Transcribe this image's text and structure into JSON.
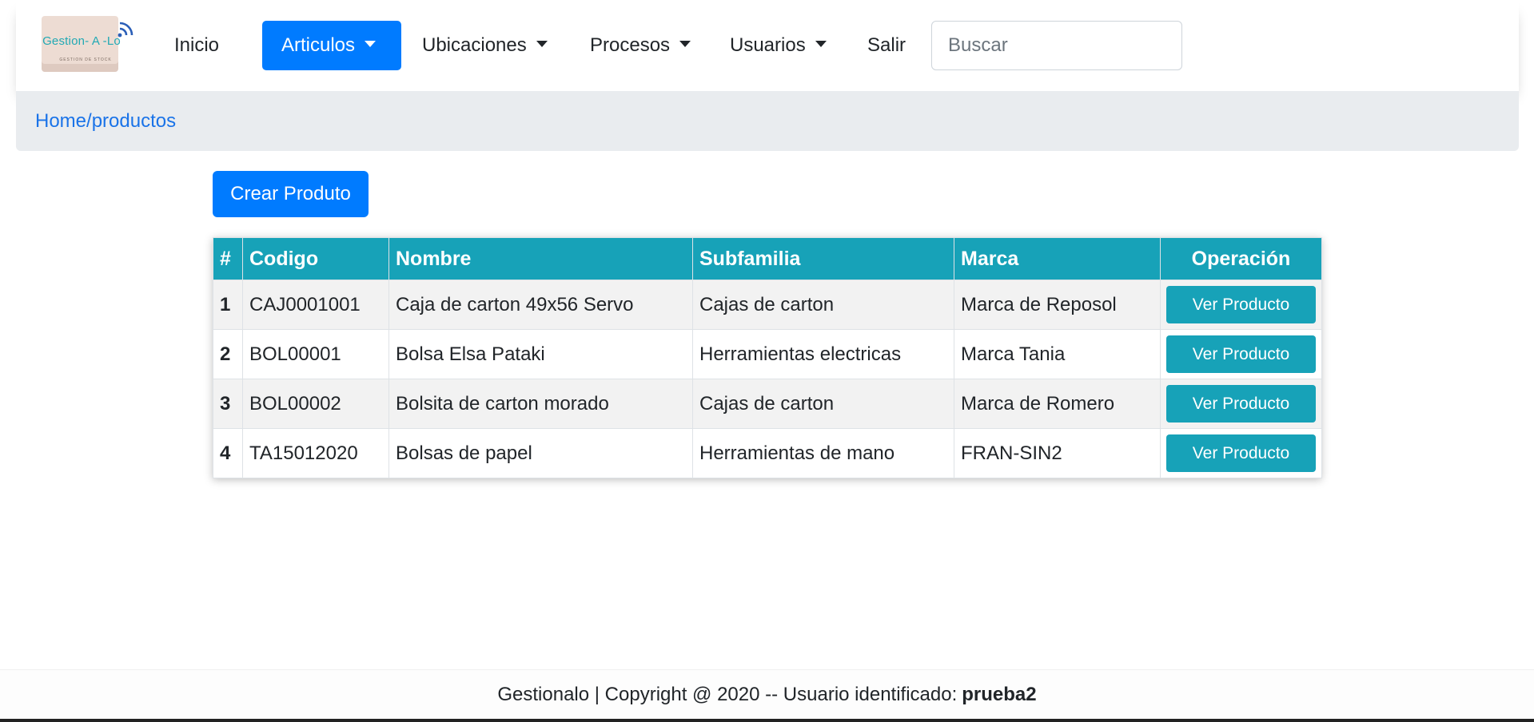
{
  "logo": {
    "text": "Gestion- A -Lo",
    "subtitle": "GESTION DE STOCK"
  },
  "nav": {
    "items": [
      {
        "label": "Inicio",
        "dropdown": false,
        "active": false
      },
      {
        "label": "Articulos",
        "dropdown": true,
        "active": true
      },
      {
        "label": "Ubicaciones",
        "dropdown": true,
        "active": false
      },
      {
        "label": "Procesos",
        "dropdown": true,
        "active": false
      },
      {
        "label": "Usuarios",
        "dropdown": true,
        "active": false
      },
      {
        "label": "Salir",
        "dropdown": false,
        "active": false
      }
    ],
    "search_placeholder": "Buscar"
  },
  "breadcrumb": "Home/productos",
  "create_button": "Crear Produto",
  "table": {
    "headers": [
      "#",
      "Codigo",
      "Nombre",
      "Subfamilia",
      "Marca",
      "Operación"
    ],
    "rows": [
      {
        "num": "1",
        "codigo": "CAJ0001001",
        "nombre": "Caja de carton 49x56 Servo",
        "subfamilia": "Cajas de carton",
        "marca": "Marca de Reposol",
        "action": "Ver Producto"
      },
      {
        "num": "2",
        "codigo": "BOL00001",
        "nombre": "Bolsa Elsa Pataki",
        "subfamilia": "Herramientas electricas",
        "marca": "Marca Tania",
        "action": "Ver Producto"
      },
      {
        "num": "3",
        "codigo": "BOL00002",
        "nombre": "Bolsita de carton morado",
        "subfamilia": "Cajas de carton",
        "marca": "Marca de Romero",
        "action": "Ver Producto"
      },
      {
        "num": "4",
        "codigo": "TA15012020",
        "nombre": "Bolsas de papel",
        "subfamilia": "Herramientas de mano",
        "marca": "FRAN-SIN2",
        "action": "Ver Producto"
      }
    ]
  },
  "footer": {
    "text": "Gestionalo | Copyright @ 2020 -- Usuario identificado:",
    "user": "prueba2"
  },
  "colors": {
    "primary": "#007bff",
    "info": "#17a2b8",
    "breadcrumb_bg": "#e9ecef"
  }
}
